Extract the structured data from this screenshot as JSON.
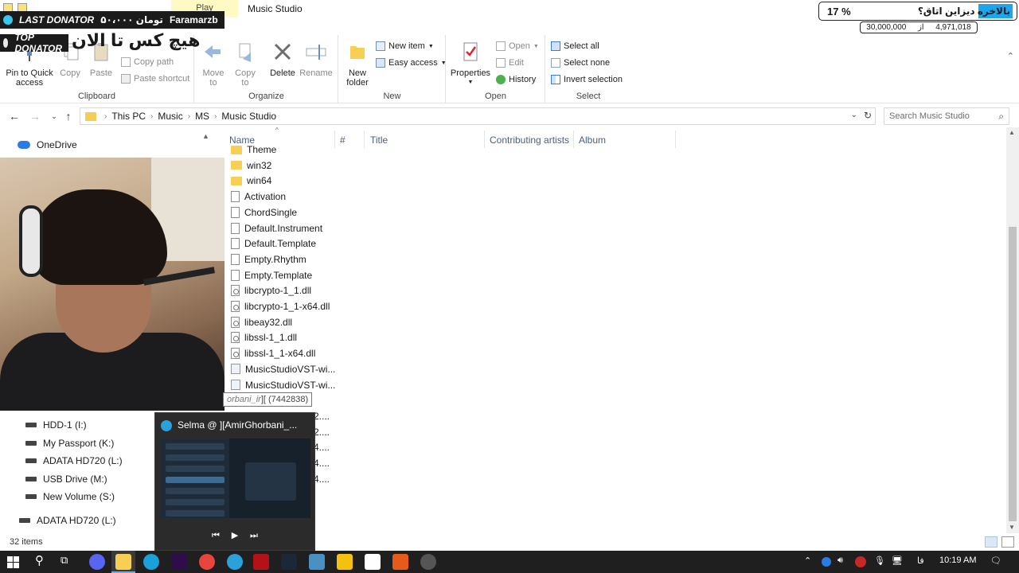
{
  "window": {
    "title": "Music Studio",
    "contextual_tab": "Play"
  },
  "ribbon": {
    "groups": {
      "clipboard": "Clipboard",
      "organize": "Organize",
      "new": "New",
      "open": "Open",
      "select": "Select"
    },
    "clipboard": {
      "pin": "Pin to Quick access",
      "copy": "Copy",
      "paste": "Paste",
      "copy_path": "Copy path",
      "paste_shortcut": "Paste shortcut"
    },
    "organize": {
      "move_to": "Move to",
      "copy_to": "Copy to",
      "delete": "Delete",
      "rename": "Rename"
    },
    "new": {
      "new_folder": "New folder",
      "new_item": "New item",
      "easy_access": "Easy access"
    },
    "open": {
      "properties": "Properties",
      "open": "Open",
      "edit": "Edit",
      "history": "History"
    },
    "select": {
      "select_all": "Select all",
      "select_none": "Select none",
      "invert": "Invert selection"
    }
  },
  "address": {
    "crumbs": [
      "This PC",
      "Music",
      "MS",
      "Music Studio"
    ],
    "search_placeholder": "Search Music Studio"
  },
  "nav": {
    "onedrive": "OneDrive",
    "drives": [
      "HDD-1 (I:)",
      "My Passport (K:)",
      "ADATA HD720 (L:)",
      "USB Drive (M:)",
      "New Volume (S:)"
    ],
    "extra_drive": "ADATA HD720 (L:)"
  },
  "columns": {
    "name": "Name",
    "number": "#",
    "title": "Title",
    "artists": "Contributing artists",
    "album": "Album"
  },
  "files": [
    {
      "name": "Theme",
      "type": "folder"
    },
    {
      "name": "win32",
      "type": "folder"
    },
    {
      "name": "win64",
      "type": "folder"
    },
    {
      "name": "Activation",
      "type": "file"
    },
    {
      "name": "ChordSingle",
      "type": "file"
    },
    {
      "name": "Default.Instrument",
      "type": "file"
    },
    {
      "name": "Default.Template",
      "type": "file"
    },
    {
      "name": "Empty.Rhythm",
      "type": "file"
    },
    {
      "name": "Empty.Template",
      "type": "file"
    },
    {
      "name": "libcrypto-1_1.dll",
      "type": "dll"
    },
    {
      "name": "libcrypto-1_1-x64.dll",
      "type": "dll"
    },
    {
      "name": "libeay32.dll",
      "type": "dll"
    },
    {
      "name": "libssl-1_1.dll",
      "type": "dll"
    },
    {
      "name": "libssl-1_1-x64.dll",
      "type": "dll"
    },
    {
      "name": "MusicStudioVST-wi...",
      "type": "exe"
    },
    {
      "name": "MusicStudioVST-wi...",
      "type": "exe"
    }
  ],
  "partial_rows": [
    "2....",
    "2....",
    "4....",
    "4....",
    "4...."
  ],
  "status": {
    "items": "32 items"
  },
  "overlay": {
    "last_donator_tag": "LAST DONATOR",
    "last_donator_amount": "۵۰،۰۰۰ تومان",
    "last_donator_name": "Faramarzb",
    "top_donator_tag": "TOP DONATOR",
    "top_donator_text": "هیچ کس تا الان",
    "goal_percent": "17 %",
    "goal_title": "بالاخره دیزاین اتاق؟",
    "goal_current": "4,971,018",
    "goal_of": "از",
    "goal_total": "30,000,000",
    "goal_fraction": 0.17
  },
  "tooltip": {
    "handle": "orbani_ir",
    "text": "][ (7442838)"
  },
  "telegram_thumb": {
    "title": "Selma @ ][AmirGhorbani_..."
  },
  "taskbar": {
    "time": "10:19 AM",
    "lang": "فا"
  },
  "colors": {
    "accent": "#1ea6ec",
    "folder": "#f7cf55",
    "taskbar": "#1f1f1f"
  }
}
